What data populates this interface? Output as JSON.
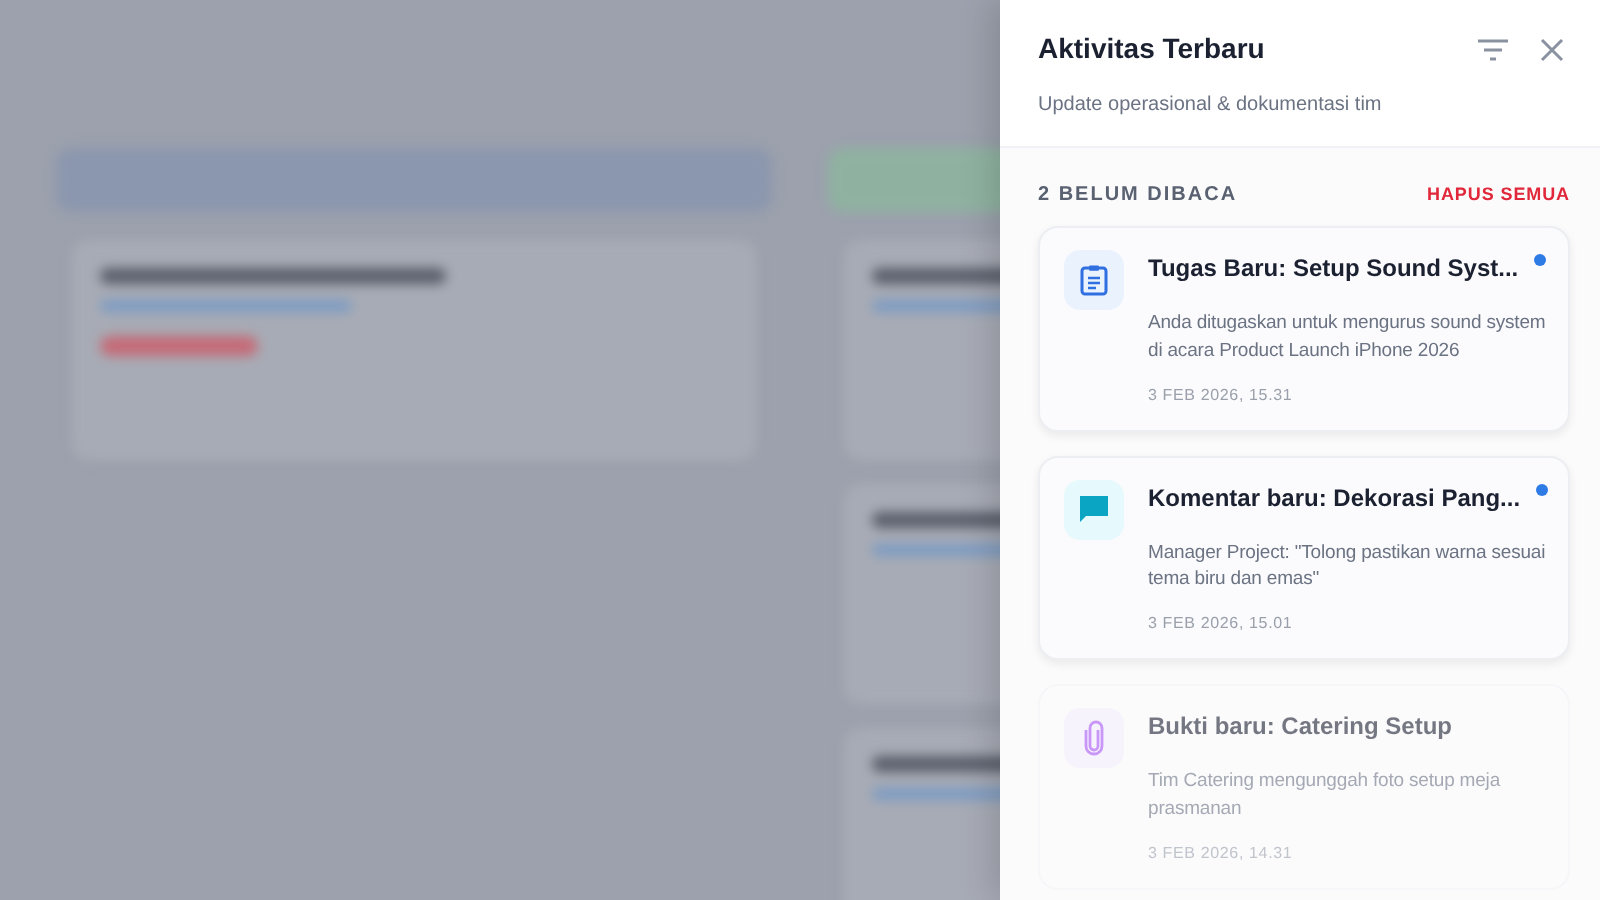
{
  "panel": {
    "title": "Aktivitas Terbaru",
    "subtitle": "Update operasional & dokumentasi tim",
    "unread_label": "2 BELUM DIBACA",
    "clear_label": "HAPUS SEMUA"
  },
  "notifications": [
    {
      "kind": "task",
      "title": "Tugas Baru: Setup Sound Syst...",
      "body": "Anda ditugaskan untuk mengurus sound system di acara Product Launch iPhone 2026",
      "time": "3 FEB 2026, 15.31",
      "unread": true
    },
    {
      "kind": "comment",
      "title": "Komentar baru: Dekorasi Pang...",
      "body": "Manager Project: \"Tolong pastikan warna sesuai tema biru dan emas\"",
      "time": "3 FEB 2026, 15.01",
      "unread": true
    },
    {
      "kind": "attachment",
      "title": "Bukti baru: Catering Setup",
      "body": "Tim Catering mengunggah foto setup meja prasmanan",
      "time": "3 FEB 2026, 14.31",
      "unread": false
    }
  ]
}
